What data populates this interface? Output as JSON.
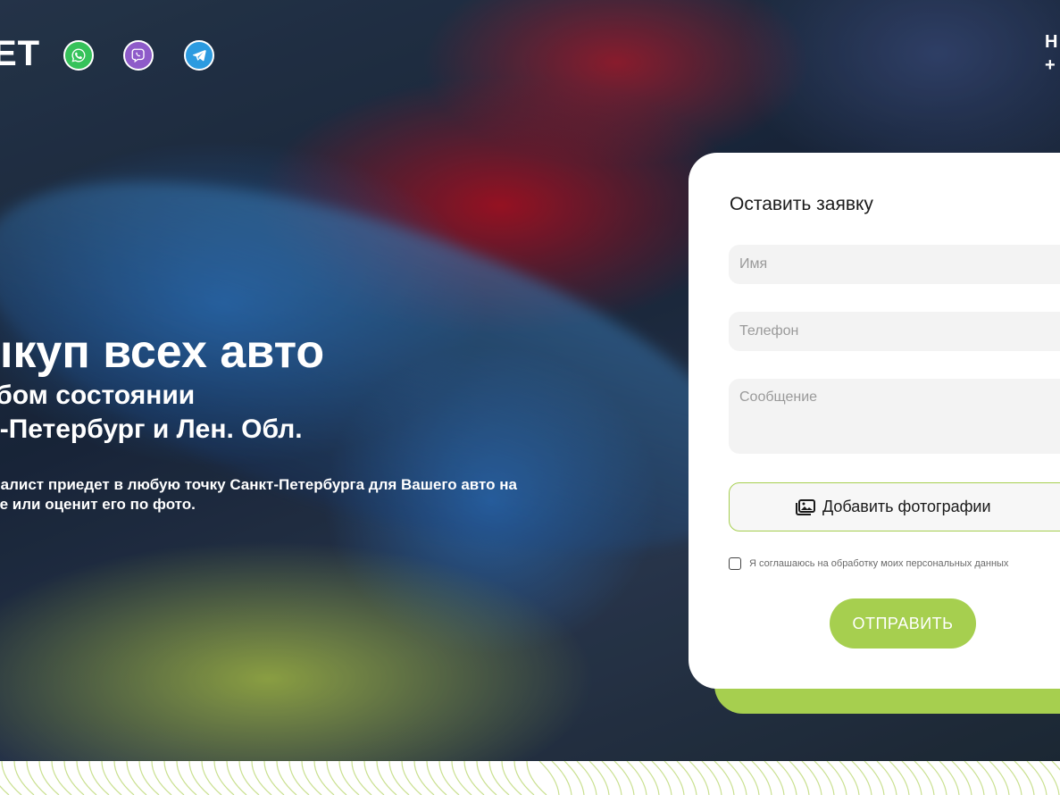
{
  "header": {
    "logo_fragment": "ЕТ",
    "top_right_line1": "Н",
    "top_right_line2": "+"
  },
  "social": [
    {
      "name": "whatsapp-icon",
      "color": "#36c25a"
    },
    {
      "name": "viber-icon",
      "color": "#8e5bc9"
    },
    {
      "name": "telegram-icon",
      "color": "#2c9be0"
    }
  ],
  "hero": {
    "title": "ыкуп всех авто",
    "subtitle1": "юбом состоянии",
    "subtitle2": "кт-Петербург и Лен. Обл.",
    "description": "пециалист приедет в любую точку Санкт-Петербурга для Вашего авто на месте или оценит его по фото."
  },
  "form": {
    "title": "Оставить заявку",
    "name_placeholder": "Имя",
    "phone_placeholder": "Телефон",
    "message_placeholder": "Сообщение",
    "photo_button": "Добавить фотографии",
    "consent_label": "Я соглашаюсь на обработку моих персональных данных",
    "submit_label": "ОТПРАВИТЬ"
  },
  "colors": {
    "accent": "#a6cf4f",
    "card_bg": "#ffffff",
    "field_bg": "#f3f3f3"
  }
}
